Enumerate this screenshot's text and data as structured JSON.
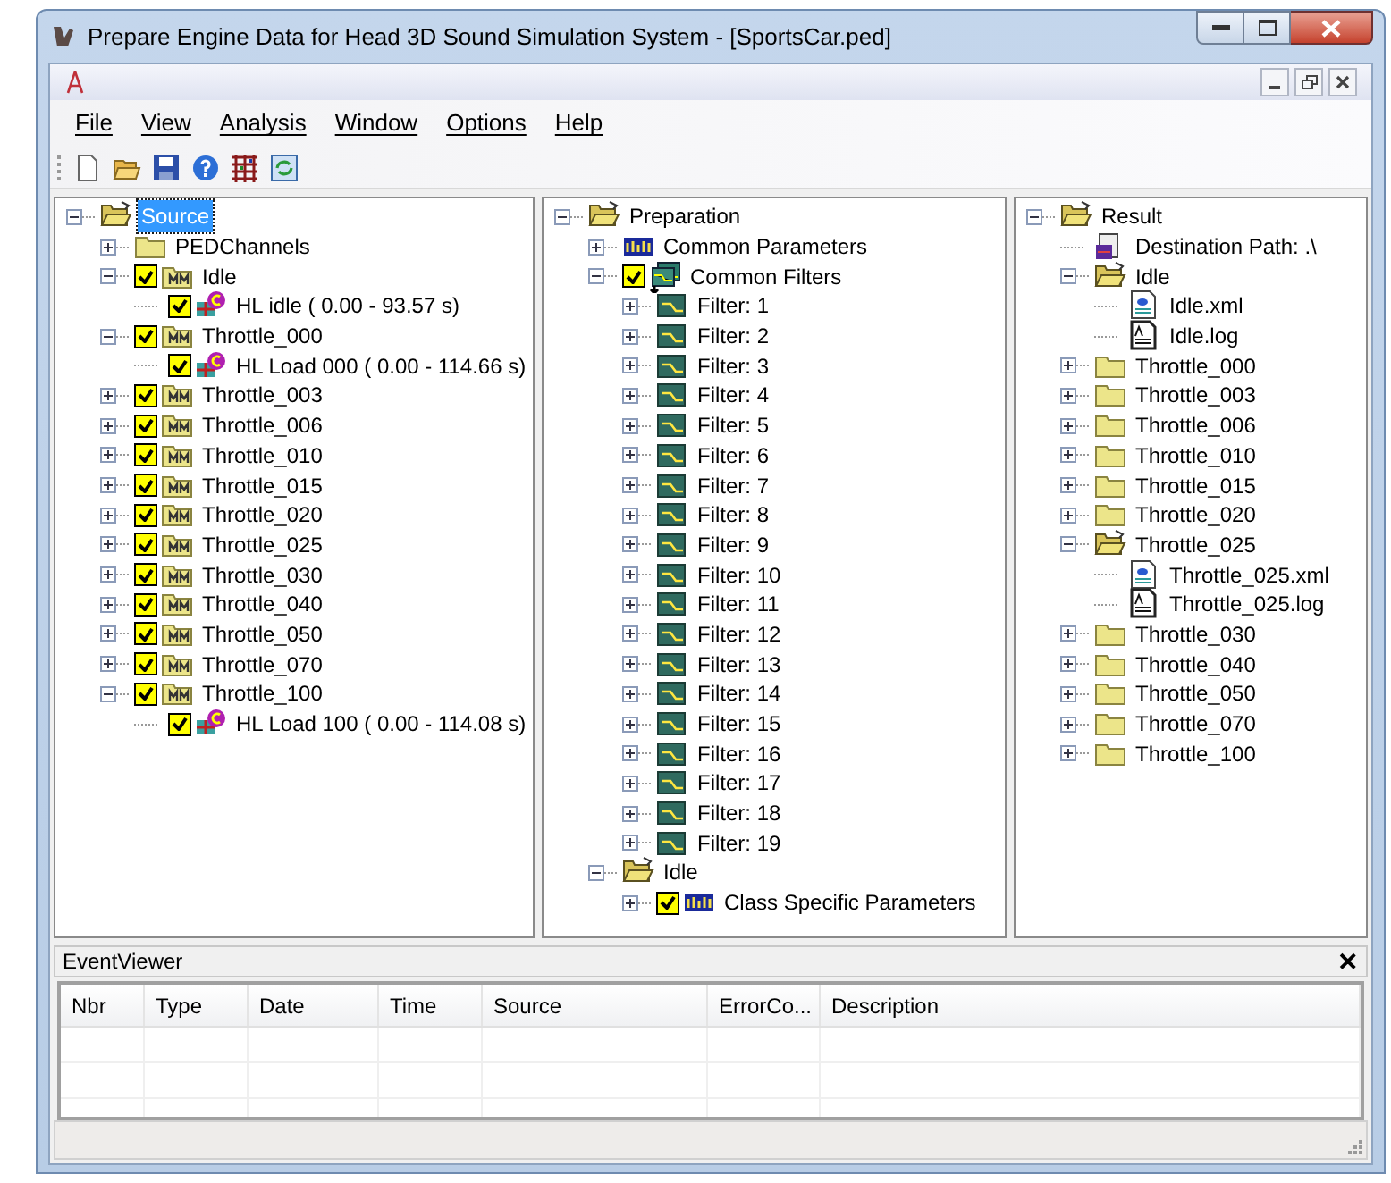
{
  "window": {
    "title": "Prepare Engine Data for Head 3D Sound Simulation System - [SportsCar.ped]"
  },
  "menu": [
    "File",
    "View",
    "Analysis",
    "Window",
    "Options",
    "Help"
  ],
  "toolbar": [
    {
      "kind": "new"
    },
    {
      "kind": "open"
    },
    {
      "kind": "save"
    },
    {
      "kind": "help"
    },
    {
      "kind": "grid"
    },
    {
      "kind": "refresh"
    }
  ],
  "trees": [
    [
      {
        "label": "Source",
        "kind": "folder-open",
        "expanded": true,
        "selected": true,
        "children": [
          {
            "label": "PEDChannels",
            "kind": "folder",
            "expanded": false,
            "selected": false
          },
          {
            "label": "Idle",
            "kind": "m-folder",
            "expanded": true,
            "checked": true,
            "selected": false,
            "children": [
              {
                "label": "HL idle ( 0.00 - 93.57 s)",
                "kind": "channel",
                "checked": true,
                "selected": false
              }
            ]
          },
          {
            "label": "Throttle_000",
            "kind": "m-folder",
            "expanded": true,
            "checked": true,
            "selected": false,
            "children": [
              {
                "label": "HL Load 000 ( 0.00 - 114.66 s)",
                "kind": "channel",
                "checked": true,
                "selected": false
              }
            ]
          },
          {
            "label": "Throttle_003",
            "kind": "m-folder",
            "expanded": false,
            "checked": true,
            "selected": false
          },
          {
            "label": "Throttle_006",
            "kind": "m-folder",
            "expanded": false,
            "checked": true,
            "selected": false
          },
          {
            "label": "Throttle_010",
            "kind": "m-folder",
            "expanded": false,
            "checked": true,
            "selected": false
          },
          {
            "label": "Throttle_015",
            "kind": "m-folder",
            "expanded": false,
            "checked": true,
            "selected": false
          },
          {
            "label": "Throttle_020",
            "kind": "m-folder",
            "expanded": false,
            "checked": true,
            "selected": false
          },
          {
            "label": "Throttle_025",
            "kind": "m-folder",
            "expanded": false,
            "checked": true,
            "selected": false
          },
          {
            "label": "Throttle_030",
            "kind": "m-folder",
            "expanded": false,
            "checked": true,
            "selected": false
          },
          {
            "label": "Throttle_040",
            "kind": "m-folder",
            "expanded": false,
            "checked": true,
            "selected": false
          },
          {
            "label": "Throttle_050",
            "kind": "m-folder",
            "expanded": false,
            "checked": true,
            "selected": false
          },
          {
            "label": "Throttle_070",
            "kind": "m-folder",
            "expanded": false,
            "checked": true,
            "selected": false
          },
          {
            "label": "Throttle_100",
            "kind": "m-folder",
            "expanded": true,
            "checked": true,
            "selected": false,
            "children": [
              {
                "label": "HL Load 100 ( 0.00 - 114.08 s)",
                "kind": "channel",
                "checked": true,
                "selected": false
              }
            ]
          }
        ]
      }
    ],
    [
      {
        "label": "Preparation",
        "kind": "folder-open",
        "expanded": true,
        "selected": false,
        "children": [
          {
            "label": "Common Parameters",
            "kind": "params",
            "expanded": false,
            "selected": false
          },
          {
            "label": "Common Filters",
            "kind": "filters",
            "expanded": true,
            "checked": true,
            "selected": false,
            "children": [
              {
                "label": "Filter: 1",
                "kind": "filter",
                "expanded": false,
                "selected": false
              },
              {
                "label": "Filter: 2",
                "kind": "filter",
                "expanded": false,
                "selected": false
              },
              {
                "label": "Filter: 3",
                "kind": "filter",
                "expanded": false,
                "selected": false
              },
              {
                "label": "Filter: 4",
                "kind": "filter",
                "expanded": false,
                "selected": false
              },
              {
                "label": "Filter: 5",
                "kind": "filter",
                "expanded": false,
                "selected": false
              },
              {
                "label": "Filter: 6",
                "kind": "filter",
                "expanded": false,
                "selected": false
              },
              {
                "label": "Filter: 7",
                "kind": "filter",
                "expanded": false,
                "selected": false
              },
              {
                "label": "Filter: 8",
                "kind": "filter",
                "expanded": false,
                "selected": false
              },
              {
                "label": "Filter: 9",
                "kind": "filter",
                "expanded": false,
                "selected": false
              },
              {
                "label": "Filter: 10",
                "kind": "filter",
                "expanded": false,
                "selected": false
              },
              {
                "label": "Filter: 11",
                "kind": "filter",
                "expanded": false,
                "selected": false
              },
              {
                "label": "Filter: 12",
                "kind": "filter",
                "expanded": false,
                "selected": false
              },
              {
                "label": "Filter: 13",
                "kind": "filter",
                "expanded": false,
                "selected": false
              },
              {
                "label": "Filter: 14",
                "kind": "filter",
                "expanded": false,
                "selected": false
              },
              {
                "label": "Filter: 15",
                "kind": "filter",
                "expanded": false,
                "selected": false
              },
              {
                "label": "Filter: 16",
                "kind": "filter",
                "expanded": false,
                "selected": false
              },
              {
                "label": "Filter: 17",
                "kind": "filter",
                "expanded": false,
                "selected": false
              },
              {
                "label": "Filter: 18",
                "kind": "filter",
                "expanded": false,
                "selected": false
              },
              {
                "label": "Filter: 19",
                "kind": "filter",
                "expanded": false,
                "selected": false
              }
            ]
          },
          {
            "label": "Idle",
            "kind": "folder-open",
            "expanded": true,
            "selected": false,
            "children": [
              {
                "label": "Class Specific Parameters",
                "kind": "params",
                "expanded": false,
                "checked": true,
                "selected": false
              }
            ]
          }
        ]
      }
    ],
    [
      {
        "label": "Result",
        "kind": "folder-open",
        "expanded": true,
        "selected": false,
        "children": [
          {
            "label": "Destination Path: .\\",
            "kind": "dest",
            "selected": false
          },
          {
            "label": "Idle",
            "kind": "folder-open",
            "expanded": true,
            "selected": false,
            "children": [
              {
                "label": "Idle.xml",
                "kind": "xml",
                "selected": false
              },
              {
                "label": "Idle.log",
                "kind": "log",
                "selected": false
              }
            ]
          },
          {
            "label": "Throttle_000",
            "kind": "folder",
            "expanded": false,
            "selected": false
          },
          {
            "label": "Throttle_003",
            "kind": "folder",
            "expanded": false,
            "selected": false
          },
          {
            "label": "Throttle_006",
            "kind": "folder",
            "expanded": false,
            "selected": false
          },
          {
            "label": "Throttle_010",
            "kind": "folder",
            "expanded": false,
            "selected": false
          },
          {
            "label": "Throttle_015",
            "kind": "folder",
            "expanded": false,
            "selected": false
          },
          {
            "label": "Throttle_020",
            "kind": "folder",
            "expanded": false,
            "selected": false
          },
          {
            "label": "Throttle_025",
            "kind": "folder-open",
            "expanded": true,
            "selected": false,
            "children": [
              {
                "label": "Throttle_025.xml",
                "kind": "xml",
                "selected": false
              },
              {
                "label": "Throttle_025.log",
                "kind": "log",
                "selected": false
              }
            ]
          },
          {
            "label": "Throttle_030",
            "kind": "folder",
            "expanded": false,
            "selected": false
          },
          {
            "label": "Throttle_040",
            "kind": "folder",
            "expanded": false,
            "selected": false
          },
          {
            "label": "Throttle_050",
            "kind": "folder",
            "expanded": false,
            "selected": false
          },
          {
            "label": "Throttle_070",
            "kind": "folder",
            "expanded": false,
            "selected": false
          },
          {
            "label": "Throttle_100",
            "kind": "folder",
            "expanded": false,
            "selected": false
          }
        ]
      }
    ]
  ],
  "event_viewer": {
    "title": "EventViewer",
    "close": "✕",
    "columns": [
      "Nbr",
      "Type",
      "Date",
      "Time",
      "Source",
      "ErrorCo...",
      "Description"
    ]
  }
}
